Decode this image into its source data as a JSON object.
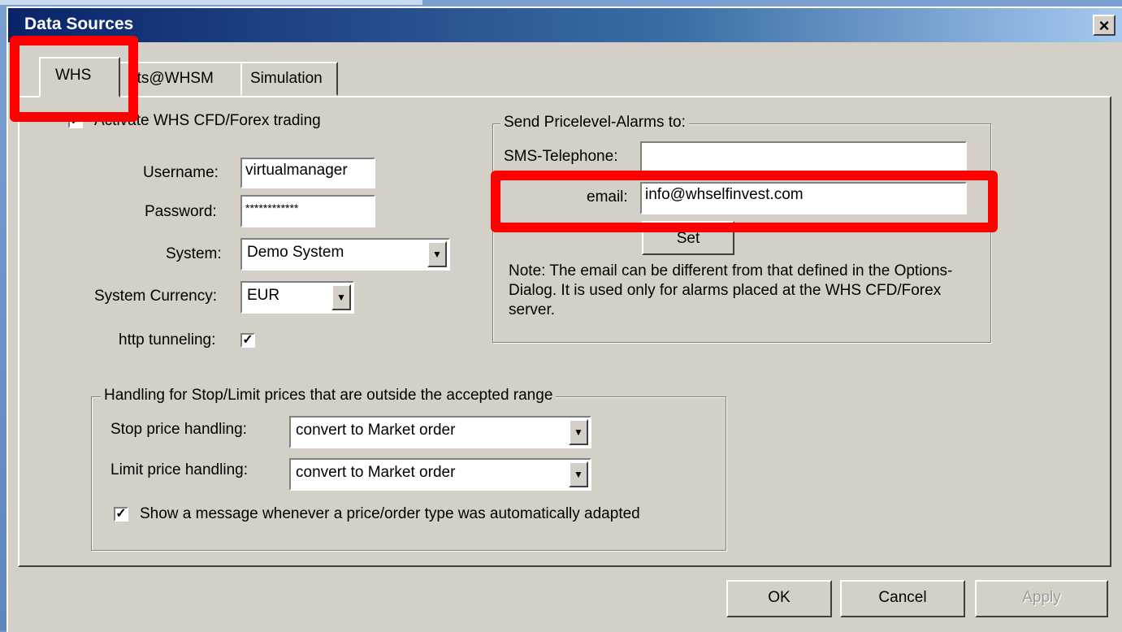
{
  "window": {
    "title": "Data Sources",
    "close_label": "×"
  },
  "tabs": [
    {
      "label": "WHS"
    },
    {
      "label": "ats@WHSM"
    },
    {
      "label": "Simulation"
    }
  ],
  "whs": {
    "activate_label": "Activate WHS CFD/Forex trading",
    "username_label": "Username:",
    "username_value": "virtualmanager",
    "password_label": "Password:",
    "password_value": "************",
    "system_label": "System:",
    "system_value": "Demo System",
    "currency_label": "System Currency:",
    "currency_value": "EUR",
    "http_label": "http tunneling:"
  },
  "alarms": {
    "legend": "Send Pricelevel-Alarms to:",
    "sms_label": "SMS-Telephone:",
    "sms_value": "",
    "email_label": "email:",
    "email_value": "info@whselfinvest.com",
    "set_label": "Set",
    "note": "Note: The email can be different from that defined in the Options-Dialog. It is used only for alarms placed at the WHS CFD/Forex server."
  },
  "handling": {
    "legend": "Handling for Stop/Limit prices that are outside the accepted range",
    "stop_label": "Stop price handling:",
    "stop_value": "convert to Market order",
    "limit_label": "Limit price handling:",
    "limit_value": "convert to Market order",
    "message_label": "Show a message whenever a price/order type was automatically adapted"
  },
  "buttons": {
    "ok": "OK",
    "cancel": "Cancel",
    "apply": "Apply"
  },
  "check_mark": "✓",
  "dropdown_glyph": "▼",
  "colors": {
    "highlight": "#ff0000",
    "titlebar": "#0a246a",
    "face": "#d4d0c8"
  }
}
